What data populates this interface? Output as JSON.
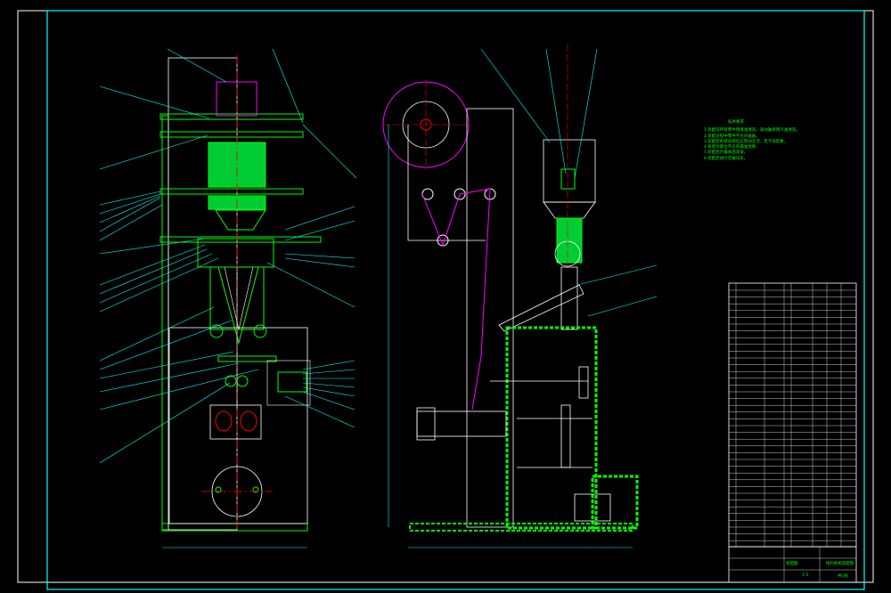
{
  "drawing": {
    "title": "",
    "tech_notes_title": "技术要求",
    "tech_notes": [
      "1.装配前所有零件用煤油清洗，滚动轴承用汽油清洗。",
      "2.装配过程中零件不允许磕碰。",
      "3.装配后各转动部位应转动灵活，无卡滞现象。",
      "4.各密封部位不应有漏油现象。",
      "5.装配后外露表面涂漆。",
      "6.装配后进行空载试车。"
    ],
    "title_block": {
      "name_cell": "给料机构装配图",
      "scale_cell": "1:5",
      "material_cell": "装配图",
      "sheet_cell": "共1张"
    },
    "colors": {
      "background": "#000000",
      "frame": "#ffffff",
      "border": "#00ffff",
      "component": "#00ff00",
      "centerline": "#ff0000",
      "hidden": "#ff00ff",
      "label_lines": "#00ffff"
    }
  }
}
